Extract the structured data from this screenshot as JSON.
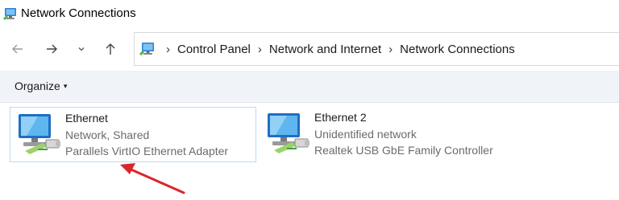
{
  "window": {
    "title": "Network Connections",
    "icon": "network-connections-icon"
  },
  "nav": {
    "back_icon": "arrow-left-icon",
    "forward_icon": "arrow-right-icon",
    "recent_icon": "chevron-down-icon",
    "up_icon": "arrow-up-icon"
  },
  "address_bar": {
    "icon": "network-connections-icon",
    "breadcrumbs": [
      "Control Panel",
      "Network and Internet",
      "Network Connections"
    ]
  },
  "command_bar": {
    "organize_label": "Organize"
  },
  "connections": [
    {
      "name": "Ethernet",
      "status": "Network, Shared",
      "adapter": "Parallels VirtIO Ethernet Adapter",
      "selected": true
    },
    {
      "name": "Ethernet 2",
      "status": "Unidentified network",
      "adapter": "Realtek USB GbE Family Controller",
      "selected": false
    }
  ],
  "annotation": {
    "type": "red-arrow",
    "color": "#d9262c"
  },
  "colors": {
    "accent": "#1e86d8",
    "selection_border": "#bcdcf4",
    "command_bar": "#f0f4f9"
  }
}
